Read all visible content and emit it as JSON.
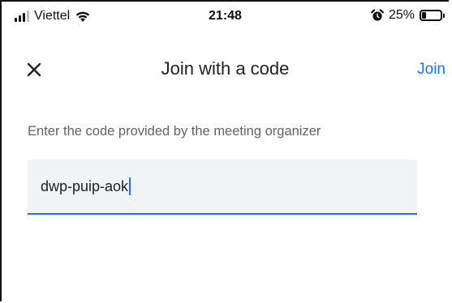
{
  "status_bar": {
    "carrier": "Viettel",
    "time": "21:48",
    "battery_percent": "25%",
    "battery_level": 0.25,
    "icons": [
      "signal-icon",
      "wifi-icon",
      "alarm-icon",
      "battery-icon"
    ]
  },
  "header": {
    "title": "Join with a code",
    "close_icon": "close-icon",
    "join_label": "Join"
  },
  "form": {
    "instruction": "Enter the code provided by the meeting organizer",
    "code_value": "dwp-puip-aok"
  },
  "colors": {
    "accent": "#1a73e8",
    "field_background": "#f1f3f4",
    "title_text": "#202124",
    "secondary_text": "#5f6368"
  }
}
